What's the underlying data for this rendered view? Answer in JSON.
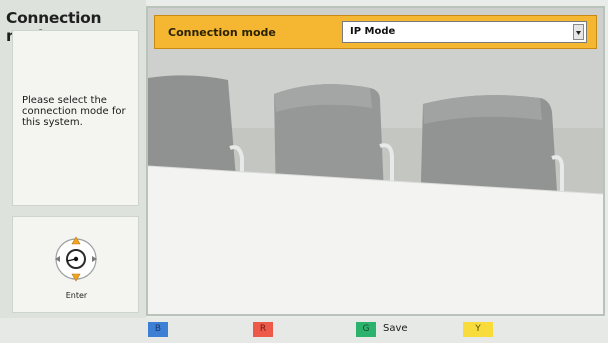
{
  "left_panel": {
    "title": "Connection mode",
    "instruction": "Please select the connection mode for this system.",
    "enter_label": "Enter"
  },
  "main": {
    "setting_label": "Connection mode",
    "setting_value": "IP Mode"
  },
  "bottom_bar": {
    "keys": [
      {
        "label": "B",
        "color": "#3c7fd4"
      },
      {
        "label": "R",
        "color": "#ee5a4a"
      },
      {
        "label": "G",
        "color": "#2bb26c"
      },
      {
        "label": "Y",
        "color": "#f7dc3c"
      }
    ],
    "green_action": "Save"
  },
  "colors": {
    "accent": "#f5b631",
    "panel": "#f4f5f1"
  },
  "icons": {
    "remote_nav": "directional-pad-icon",
    "dropdown": "dropdown-arrow-icon"
  }
}
